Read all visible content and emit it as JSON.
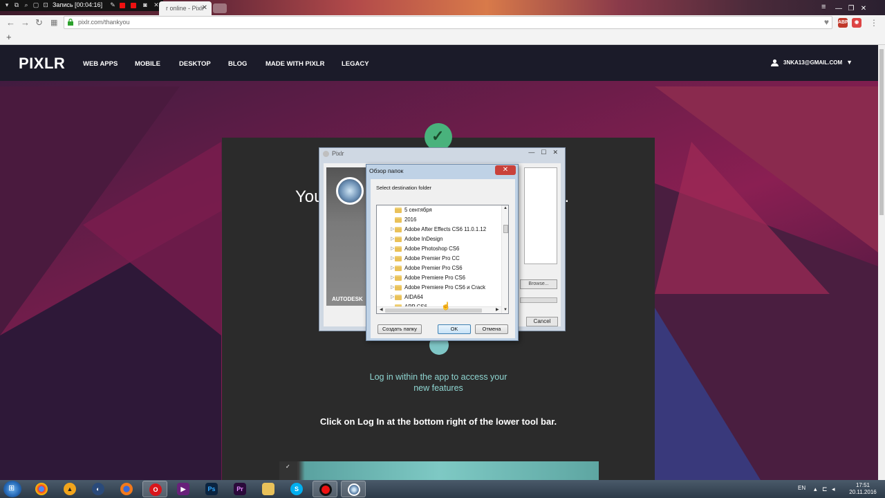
{
  "recorder": {
    "title": "Запись [00:04:16]"
  },
  "browser": {
    "tab_title": "r online - Pixlr",
    "url": "pixlr.com/thankyou",
    "new_tab_plus": "+",
    "window_controls": [
      "—",
      "❐",
      "✕"
    ]
  },
  "site": {
    "logo": "PIXLR",
    "nav": [
      "WEB APPS",
      "MOBILE",
      "DESKTOP",
      "BLOG",
      "MADE WITH PIXLR",
      "LEGACY"
    ],
    "user_email": "3NKA13@GMAIL.COM",
    "headline_left": "You",
    "headline_right": "y...",
    "login_text": "Log in within the app to access your new features",
    "click_text": "Click on Log In at the bottom right of the lower tool bar."
  },
  "pixlr_window": {
    "title": "Pixlr",
    "brand": "AUTODESK",
    "browse_label": "Browse...",
    "cancel_label": "Cancel"
  },
  "folder_dialog": {
    "title": "Обзор папок",
    "prompt": "Select destination folder",
    "folders": [
      "5 сентября",
      "2016",
      "Adobe After Effects CS6 11.0.1.12",
      "Adobe InDesign",
      "Adobe Photoshop CS6",
      "Adobe Premier Pro CC",
      "Adobe Premier Pro CS6",
      "Adobe Premiere Pro CS6",
      "Adobe Premiere Pro CS6 и Crack",
      "AIDA64",
      "APP CS6"
    ],
    "create_folder_label": "Создать папку",
    "ok_label": "OK",
    "cancel_label": "Отмена"
  },
  "taskbar": {
    "lang": "EN",
    "time": "17:51",
    "date": "20.11.2016",
    "apps": [
      "chrome-icon",
      "aimp-icon",
      "cinema4d-icon",
      "firefox-icon",
      "opera-icon",
      "visualstudio-icon",
      "photoshop-icon",
      "premiere-icon",
      "explorer-icon",
      "skype-icon",
      "record-icon",
      "pixlr-icon"
    ]
  },
  "colors": {
    "brand_nav": "#1b1b29",
    "success": "#49b27c",
    "accent_teal": "#8fd6d2"
  }
}
